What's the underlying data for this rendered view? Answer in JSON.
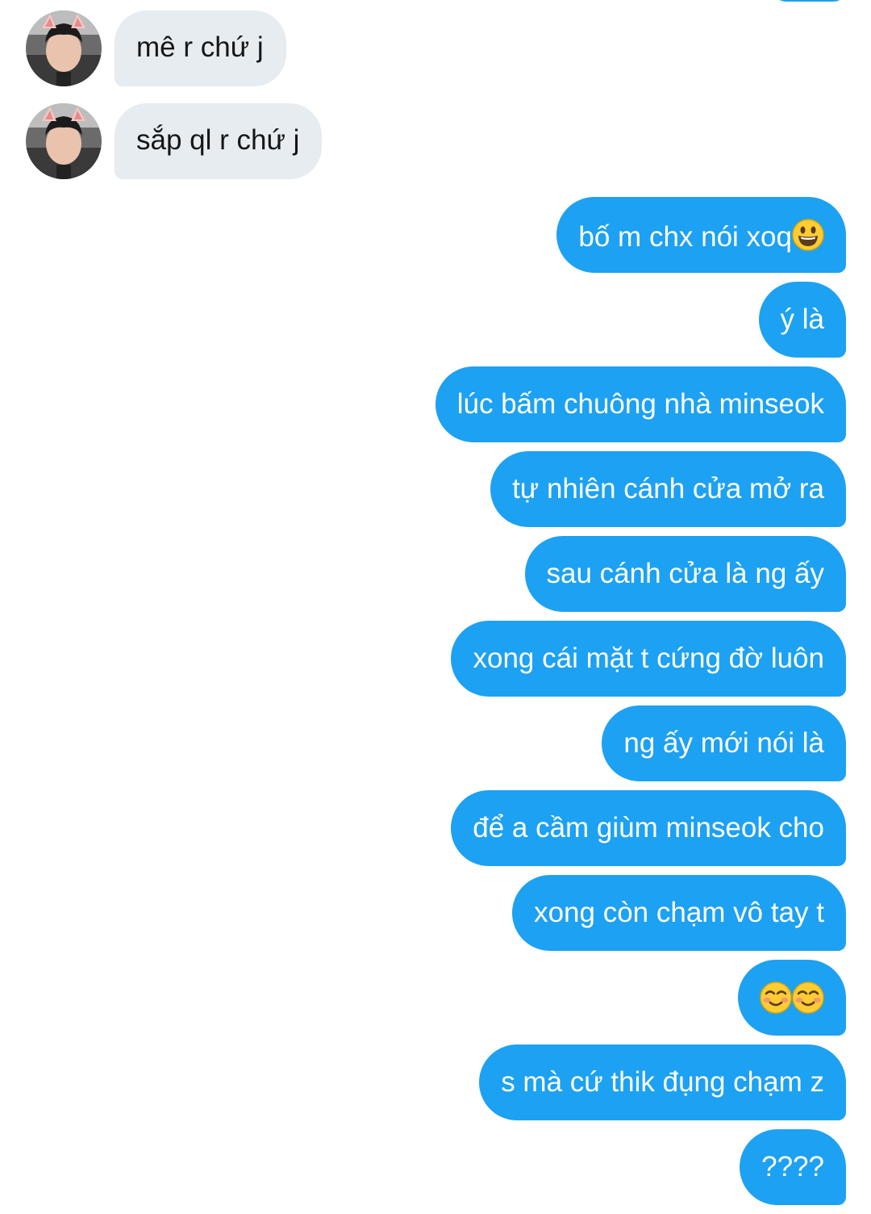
{
  "conversation": {
    "incoming": [
      {
        "text": "mê r chứ j",
        "avatar_icon": "cat-ear-avatar"
      },
      {
        "text": "sắp ql r chứ j",
        "avatar_icon": "cat-ear-avatar"
      }
    ],
    "outgoing": [
      {
        "text": "bố m chx nói xoq",
        "emoji": "smiley-face-icon"
      },
      {
        "text": "ý là"
      },
      {
        "text": "lúc bấm chuông nhà minseok"
      },
      {
        "text": "tự nhiên cánh cửa mở ra"
      },
      {
        "text": "sau cánh cửa là ng ấy"
      },
      {
        "text": "xong cái mặt t cứng đờ luôn"
      },
      {
        "text": "ng ấy mới nói là"
      },
      {
        "text": "để a cầm giùm minseok cho"
      },
      {
        "text": "xong còn chạm vô tay t"
      },
      {
        "text": "",
        "emojis": [
          "blush-face-icon",
          "blush-face-icon"
        ]
      },
      {
        "text": "s mà cứ thik đụng chạm z"
      },
      {
        "text": "????"
      }
    ]
  },
  "colors": {
    "outgoing_bubble": "#1da1f2",
    "incoming_bubble": "#e6ecf0",
    "incoming_text": "#14171a",
    "outgoing_text": "#ffffff"
  }
}
